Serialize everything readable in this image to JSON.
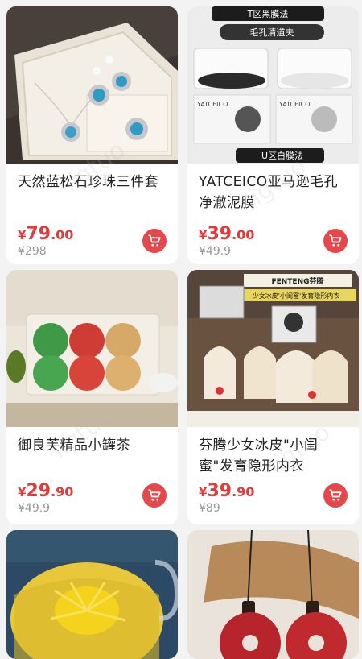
{
  "watermark": "ligtuo",
  "products": [
    {
      "title": "天然蓝松石珍珠三件套",
      "currency": "¥",
      "price_int": "79",
      "price_dec": ".00",
      "original": "¥298",
      "image": "turquoise-pearl-jewelry-set-photo"
    },
    {
      "title": "YATCEICO亚马逊毛孔净澈泥膜",
      "currency": "¥",
      "price_int": "39",
      "price_dec": ".00",
      "original": "¥49.9",
      "image": "clay-mask-jars-photo",
      "image_text": {
        "top": "T区黑膜法",
        "mid": "毛孔清道夫",
        "brand1": "YATCEICO",
        "brand2": "YATCEICO",
        "bottom": "U区白膜法"
      }
    },
    {
      "title": "御良芙精品小罐茶",
      "currency": "¥",
      "price_int": "29",
      "price_dec": ".90",
      "original": "¥49.9",
      "image": "tea-tins-box-photo"
    },
    {
      "title": "芬腾少女冰皮\"小闺蜜\"发育隐形内衣",
      "currency": "¥",
      "price_int": "39",
      "price_dec": ".90",
      "original": "¥89",
      "image": "girls-underwear-photo",
      "image_text": {
        "brand": "FENTENG芬腾",
        "banner": "少女冰皮'小闺蜜'发育隐形内衣"
      }
    },
    {
      "title": "",
      "image": "chrysanthemum-tea-cup-photo"
    },
    {
      "title": "",
      "image": "red-jade-pendant-photo"
    }
  ],
  "colors": {
    "price": "#e23b3b",
    "cart_button": "#e5484a",
    "background": "#f3f3f3"
  },
  "icons": {
    "cart": "shopping-cart-icon"
  }
}
